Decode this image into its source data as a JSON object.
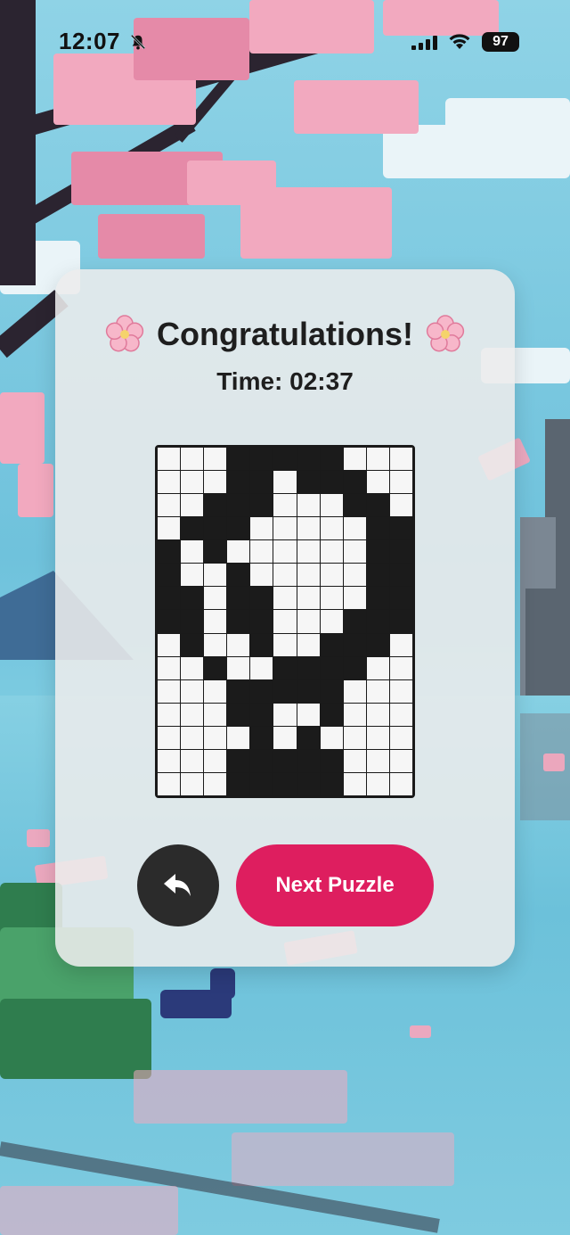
{
  "status_bar": {
    "time": "12:07",
    "battery": "97",
    "icons": [
      "bell-slash-icon",
      "cellular-signal-icon",
      "wifi-icon",
      "battery-icon"
    ]
  },
  "dialog": {
    "title": "Congratulations!",
    "title_icon": "cherry-blossom-icon",
    "time_label": "Time:",
    "time_value": "02:37",
    "undo_icon": "undo-arrow-icon",
    "next_button_label": "Next Puzzle"
  },
  "puzzle": {
    "columns": 11,
    "rows": 15,
    "solution": [
      "00011111000",
      "00011011100",
      "00111000110",
      "01110000011",
      "10100000011",
      "10010000011",
      "11011000011",
      "11011000111",
      "01001001110",
      "00100111100",
      "00011111000",
      "00011001000",
      "00001010000",
      "00011111000",
      "00011111000"
    ]
  },
  "colors": {
    "accent": "#de1e5f",
    "undo_button": "#2b2b2b",
    "filled_cell": "#1b1b1b",
    "empty_cell": "#f6f6f6",
    "card": "#ececec"
  }
}
